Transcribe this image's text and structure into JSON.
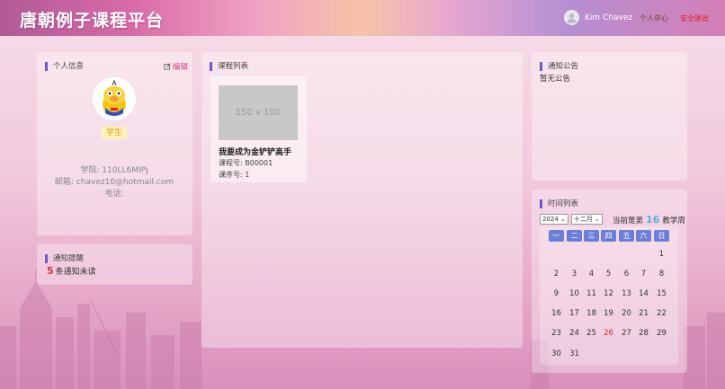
{
  "header": {
    "title": "唐朝例子课程平台",
    "user_name": "Kim Chavez",
    "profile_link": "个人中心",
    "logout_link": "安全退出"
  },
  "profile": {
    "title": "个人信息",
    "edit_label": "编辑",
    "role": "学生",
    "college": "学院: 110LL6MIPj",
    "email": "邮箱: chavez10@hotmail.com",
    "phone": "电话:"
  },
  "notifications": {
    "title": "通知提醒",
    "count": "5",
    "text": "条通知未读"
  },
  "courses": {
    "title": "课程列表",
    "items": [
      {
        "thumb": "150 x 100",
        "name": "我要成为金铲铲高手",
        "course_no": "课程号: B00001",
        "seq_no": "课序号: 1"
      }
    ]
  },
  "announcement": {
    "title": "通知公告",
    "empty": "暂无公告"
  },
  "calendar": {
    "title": "时间列表",
    "year": "2024",
    "month": "十二月",
    "week_prefix": "当前是第",
    "week": "16",
    "week_suffix": "教学周",
    "weekdays": [
      "一",
      "二",
      "三",
      "四",
      "五",
      "六",
      "日"
    ],
    "today": "26",
    "rows": [
      [
        "",
        "",
        "",
        "",
        "",
        "",
        "1"
      ],
      [
        "2",
        "3",
        "4",
        "5",
        "6",
        "7",
        "8"
      ],
      [
        "9",
        "10",
        "11",
        "12",
        "13",
        "14",
        "15"
      ],
      [
        "16",
        "17",
        "18",
        "19",
        "20",
        "21",
        "22"
      ],
      [
        "23",
        "24",
        "25",
        "26",
        "27",
        "28",
        "29"
      ],
      [
        "30",
        "31",
        "",
        "",
        "",
        "",
        ""
      ]
    ]
  },
  "colors": {
    "accent": "#6a5acd",
    "weekday_bg": "#6a7fd8",
    "alert": "#e03040"
  }
}
